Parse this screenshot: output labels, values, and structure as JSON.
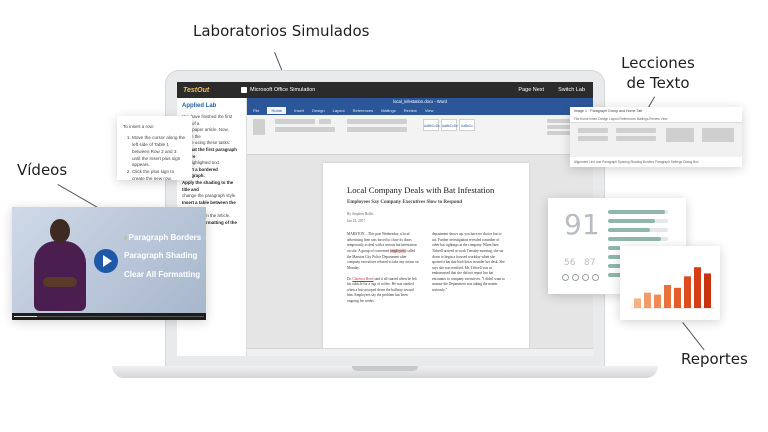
{
  "callouts": {
    "simulated_labs": "Laboratorios Simulados",
    "text_lessons_line1": "Lecciones",
    "text_lessons_line2": "de Texto",
    "videos": "Vídeos",
    "reports": "Reportes"
  },
  "app": {
    "logo": "TestOut",
    "title": "Microsoft Office Simulation",
    "right_1": "Page Next",
    "right_2": "Switch Lab"
  },
  "sidebar": {
    "heading": "Applied Lab",
    "line_1": "You have finished the first draft of a",
    "line_2": "newspaper article. Now, polish the",
    "line_3": "article using these tasks:",
    "line_4": "Format the first paragraph ignore",
    "line_5": "the highlighted text.",
    "line_6": "Insert a bordered paragraph.",
    "line_7": "Apply the shading to the title and",
    "line_8": "change the paragraph style.",
    "line_9": "Insert a table between the flagged",
    "line_10": "paragraphs in the article.",
    "line_11": "Clear the formatting of the text."
  },
  "word": {
    "title_bar": "local_infestation.docx - Word",
    "tabs": [
      "File",
      "Home",
      "Insert",
      "Design",
      "Layout",
      "References",
      "Mailings",
      "Review",
      "View"
    ],
    "styles": [
      "AaBbCcDc",
      "AaBbCcDc",
      "AaBbCc"
    ],
    "doc_title": "Local Company Deals with Bat Infestation",
    "doc_subtitle": "Employees Say Company Executives Slow to Respond",
    "byline": "By Stephen Hollis",
    "date": "Jan 23, 2017",
    "col1": "MARSTON – This past Wednesday, a local advertising firm was forced to close its doors temporarily to deal with a serious bat infestation on site. A group of concerned ",
    "col1_mark": "employees",
    "col1_b": " called the Marston City Police Department after company executives refused to take any action on Monday.",
    "col1_c": "Dr. ",
    "col1_sel": "Clarence Reed",
    "col1_d": " said it all started when he left his cubicle for a cup of coffee. He was startled when a bat swooped down the hallway toward him. Employees say the problem has been ongoing for weeks.",
    "col2": "department shows up, you have no choice but to act. Further investigation revealed a number of other bat sightings at the company. When Inez Tidwell arrived at work Tuesday morning, she sat down to begin a focused workday when she spotted a bat that had flown in under her desk. She says she was terrified. Mr. Tidwell was so embarrassed that she did not report her bat encounter to company executives. \"I didn't want to assume the Department was taking the matter seriously.\""
  },
  "steps_card": {
    "title": "To insert a row:",
    "step_1": "Move the cursor along the left side of Table 1 between Row 2 and 3 until the Insert plus sign appears.",
    "step_2": "Click the plus sign to create the new row."
  },
  "video": {
    "item_1": "Paragraph Borders",
    "item_2": "Paragraph Shading",
    "item_3": "Clear All Formatting",
    "progress": 0.12
  },
  "text_lesson": {
    "title": "Image 1 · Paragraph Group and Home Tab",
    "tabs": "File   Home   Insert   Design   Layout   References   Mailings   Review   View",
    "steps": "Alignment   Line and Paragraph Spacing   Shading   Borders   Paragraph Settings Dialog Box"
  },
  "reports": {
    "big_number": "91",
    "small_1": "56",
    "small_2": "87",
    "bar_levels": [
      0.95,
      0.78,
      0.7,
      0.88,
      0.6,
      0.82,
      0.5,
      0.74
    ],
    "column_levels": [
      0.2,
      0.32,
      0.28,
      0.48,
      0.42,
      0.66,
      0.85,
      0.72
    ],
    "bar_color": "#8fb7ae",
    "column_colors": [
      "#f4b183",
      "#f19a6a",
      "#ef8a54",
      "#e9713b",
      "#e35d2a",
      "#dd4b1f",
      "#d63c16",
      "#c9340f"
    ]
  }
}
